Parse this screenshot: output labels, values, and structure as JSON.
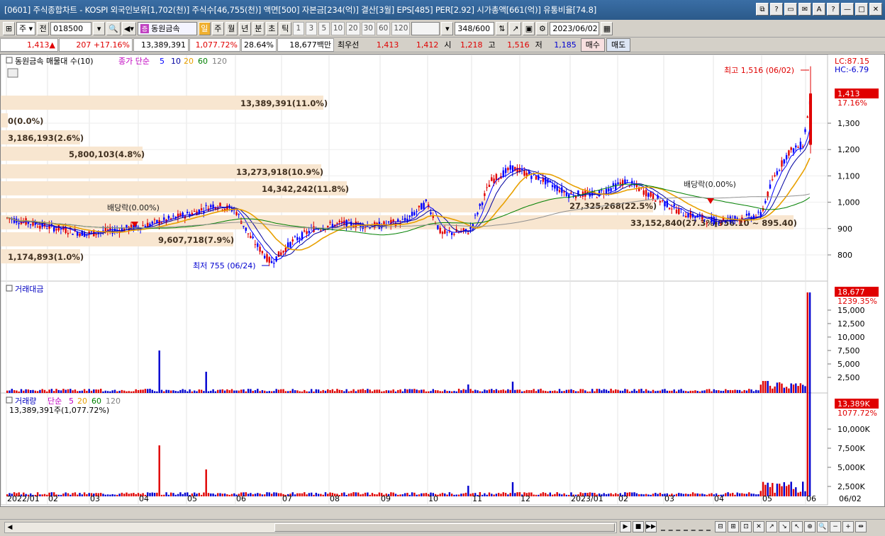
{
  "window": {
    "title": "[0601] 주식종합차트 - KOSPI 외국인보유[1,702(천)] 주식수[46,755(천)] 액면[500] 자본금[234(억)] 결산[3월] EPS[485] PER[2.92] 시가총액[661(억)] 유통비율[74.8]",
    "buttons": [
      "⧉",
      "?",
      "▭",
      "✉",
      "A",
      "?",
      "—",
      "□",
      "✕"
    ]
  },
  "toolbar": {
    "mode": "주",
    "prev": "전",
    "code": "018500",
    "stock_name": "동원금속",
    "periods": [
      "일",
      "주",
      "월",
      "년",
      "분",
      "초",
      "틱"
    ],
    "active_period": "일",
    "intervals": [
      "1",
      "3",
      "5",
      "10",
      "20",
      "30",
      "60",
      "120"
    ],
    "count": "348",
    "total": "/600",
    "date": "2023/06/02"
  },
  "quote": {
    "price": "1,413▲",
    "change": "207",
    "change_pct": "+17.16%",
    "volume": "13,389,391",
    "volume_pct": "1,077.72%",
    "turnover": "28.64%",
    "amount": "18,677백만",
    "best_label": "최우선",
    "best_ask": "1,413",
    "best_bid": "1,412",
    "open_label": "시",
    "open": "1,218",
    "high_label": "고",
    "high": "1,516",
    "low_label": "저",
    "low": "1,185",
    "buy_button": "매수",
    "sell_button": "매도"
  },
  "price_panel": {
    "legend_title": "동원금속 매물대 수(10)",
    "legend_ma_label": "종가 단순",
    "ma": [
      {
        "label": "5",
        "color": "#0000ff"
      },
      {
        "label": "10",
        "color": "#0000a0"
      },
      {
        "label": "20",
        "color": "#e8a000"
      },
      {
        "label": "60",
        "color": "#008000"
      },
      {
        "label": "120",
        "color": "#808080"
      }
    ],
    "lc": "LC:87.15",
    "hc": "HC:-6.79",
    "last_price": "1,413",
    "last_pct": "17.16%",
    "y_ticks": [
      "1,300",
      "1,200",
      "1,100",
      "1,000",
      "900",
      "800"
    ],
    "high_note": "최고 1,516 (06/02)",
    "low_note": "최저 755 (06/24)",
    "dividend_note_1": "배당락(0.00%)",
    "dividend_note_2": "배당락(0.00%)",
    "volume_profile": [
      "13,389,391(11.0%)",
      "0(0.0%)",
      "3,186,193(2.6%)",
      "5,800,103(4.8%)",
      "13,273,918(10.9%)",
      "14,342,242(11.8%)",
      "27,325,268(22.5%)",
      "33,152,840(27.3%)",
      "9,607,718(7.9%)",
      "1,174,893(1.0%)"
    ],
    "ma_overlap_text": "(956.10 ~ 895.40)"
  },
  "amount_panel": {
    "title": "거래대금",
    "last_value": "18,677",
    "last_pct": "1239.35%",
    "y_ticks": [
      "15,000",
      "12,500",
      "10,000",
      "7,500",
      "5,000",
      "2,500"
    ]
  },
  "volume_panel": {
    "title": "거래량",
    "legend_ma_label": "단순",
    "ma": [
      "5",
      "20",
      "60",
      "120"
    ],
    "sub": "13,389,391주(1,077.72%)",
    "last_value": "13,389K",
    "last_pct": "1077.72%",
    "y_ticks": [
      "10,000K",
      "7,500K",
      "5,000K",
      "2,500K"
    ]
  },
  "x_axis": [
    "2022/01",
    "02",
    "03",
    "04",
    "05",
    "06",
    "07",
    "08",
    "09",
    "10",
    "11",
    "12",
    "2023/01",
    "02",
    "03",
    "04",
    "05",
    "06"
  ],
  "x_axis_right": "06/02",
  "bottom_nav": [
    "▶",
    "■",
    "▶▶"
  ]
}
